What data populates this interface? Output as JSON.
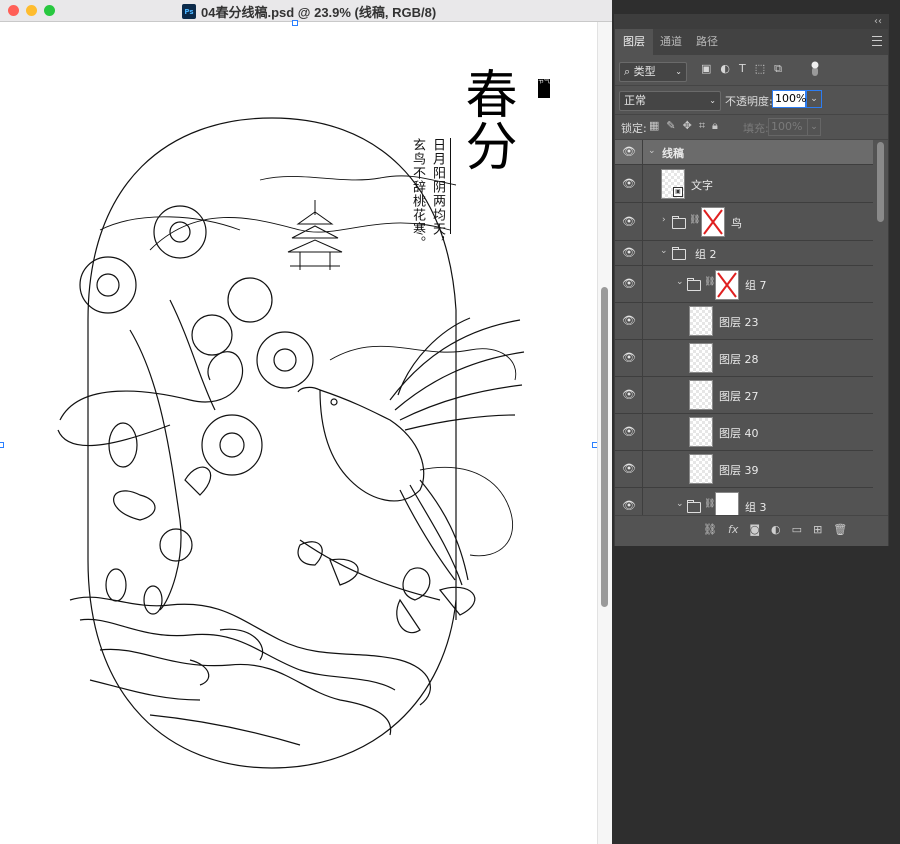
{
  "window": {
    "title": "04春分线稿.psd @ 23.9% (线稿, RGB/8)",
    "app_icon_label": "Ps",
    "traffic_lights": [
      "#ff5f57",
      "#febc2e",
      "#28c840"
    ]
  },
  "artwork": {
    "title": "春分",
    "poem_line1": "日月阳阴两均天，",
    "poem_line2": "玄鸟不辞桃花寒。",
    "seal": "节气"
  },
  "panel": {
    "tabs": [
      {
        "label": "图层",
        "active": true
      },
      {
        "label": "通道",
        "active": false
      },
      {
        "label": "路径",
        "active": false
      }
    ],
    "filter": {
      "kind_label": "类型",
      "icons": [
        "image-filter-icon",
        "adjustment-filter-icon",
        "text-filter-icon",
        "shape-filter-icon",
        "smart-object-filter-icon"
      ]
    },
    "blend_mode": "正常",
    "opacity_label": "不透明度:",
    "opacity_value": "100%",
    "lock_label": "锁定:",
    "fill_label": "填充:",
    "fill_value": "100%",
    "layers": [
      {
        "name": "线稿",
        "type": "group",
        "indent": 0,
        "expanded": true,
        "selected": true
      },
      {
        "name": "文字",
        "type": "smart-object",
        "indent": 1
      },
      {
        "name": "鸟",
        "type": "group",
        "indent": 1,
        "expanded": false,
        "has_mask": true
      },
      {
        "name": "组 2",
        "type": "group",
        "indent": 1,
        "expanded": true
      },
      {
        "name": "组 7",
        "type": "group",
        "indent": 2,
        "expanded": true,
        "has_mask": true
      },
      {
        "name": "图层 23",
        "type": "pixel",
        "indent": 3
      },
      {
        "name": "图层 28",
        "type": "pixel",
        "indent": 3
      },
      {
        "name": "图层 27",
        "type": "pixel",
        "indent": 3
      },
      {
        "name": "图层 40",
        "type": "pixel",
        "indent": 3
      },
      {
        "name": "图层 39",
        "type": "pixel",
        "indent": 3
      },
      {
        "name": "组 3",
        "type": "group",
        "indent": 2,
        "expanded": true,
        "has_mask": true
      }
    ],
    "bottom_actions": [
      "link-layers-icon",
      "fx-icon",
      "add-mask-icon",
      "adjustment-layer-icon",
      "new-group-icon",
      "new-layer-icon",
      "delete-layer-icon"
    ]
  },
  "colors": {
    "selection_blue": "#2d7df2",
    "panel_bg": "#535353"
  }
}
